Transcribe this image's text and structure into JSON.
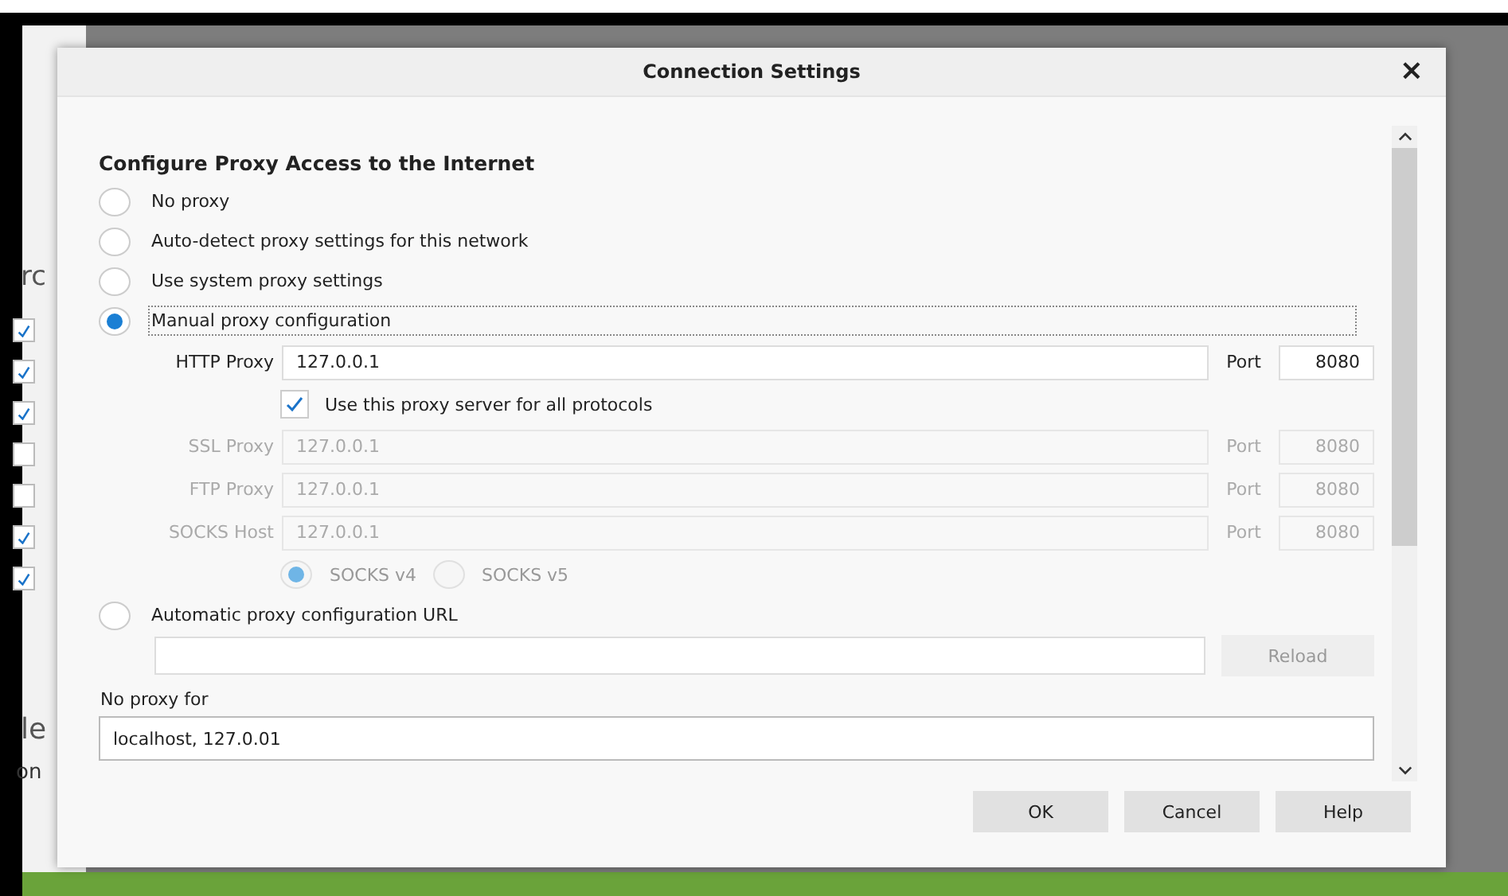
{
  "background_window": {
    "fragments": [
      {
        "text": "rc"
      },
      {
        "text": "le"
      },
      {
        "text": "on"
      }
    ],
    "checkboxes": [
      {
        "checked": true
      },
      {
        "checked": true
      },
      {
        "checked": true
      },
      {
        "checked": false
      },
      {
        "checked": false
      },
      {
        "checked": true
      },
      {
        "checked": true
      }
    ]
  },
  "dialog": {
    "title": "Connection Settings",
    "close": "×",
    "heading": "Configure Proxy Access to the Internet",
    "modes": [
      {
        "kind": "plain",
        "label": "No proxy",
        "selected": false
      },
      {
        "kind": "plain",
        "label": "Auto-detect proxy settings for this network",
        "selected": false
      },
      {
        "kind": "plain",
        "label": "Use system proxy settings",
        "selected": false
      },
      {
        "kind": "manual",
        "label": "Manual proxy configuration",
        "selected": true
      },
      {
        "kind": "pac",
        "label": "Automatic proxy configuration URL",
        "selected": false
      }
    ],
    "proxies": [
      {
        "label": "HTTP Proxy",
        "value": "127.0.0.1",
        "port_label": "Port",
        "port": "8080",
        "disabled": false
      },
      {
        "label": "SSL Proxy",
        "value": "127.0.0.1",
        "port_label": "Port",
        "port": "8080",
        "disabled": true
      },
      {
        "label": "FTP Proxy",
        "value": "127.0.0.1",
        "port_label": "Port",
        "port": "8080",
        "disabled": true
      },
      {
        "label": "SOCKS Host",
        "value": "127.0.0.1",
        "port_label": "Port",
        "port": "8080",
        "disabled": true
      }
    ],
    "share_all": {
      "label": "Use this proxy server for all protocols",
      "checked": true
    },
    "socks_versions": [
      {
        "label": "SOCKS v4",
        "selected": true,
        "disabled": true
      },
      {
        "label": "SOCKS v5",
        "selected": false,
        "disabled": true
      }
    ],
    "reload": {
      "label": "Reload",
      "disabled": true
    },
    "no_proxy": {
      "label": "No proxy for",
      "value": "localhost, 127.0.01"
    },
    "buttons": [
      "OK",
      "Cancel",
      "Help"
    ]
  }
}
